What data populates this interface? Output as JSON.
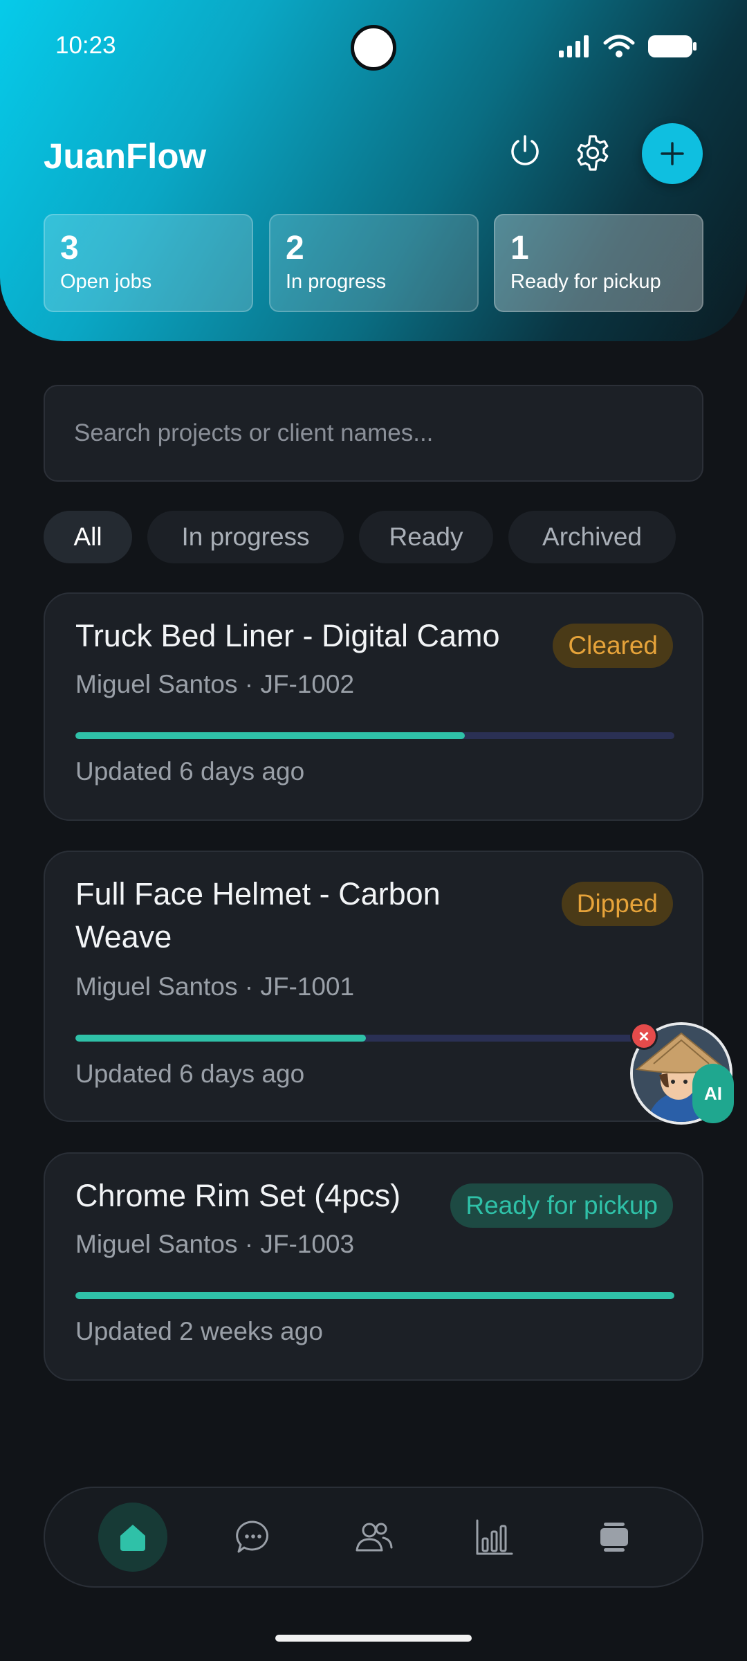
{
  "status_bar": {
    "time": "10:23"
  },
  "header": {
    "app_title": "JuanFlow",
    "power_icon": "power-icon",
    "settings_icon": "gear-icon",
    "add_icon": "plus-icon",
    "stats": [
      {
        "value": "3",
        "label": "Open jobs"
      },
      {
        "value": "2",
        "label": "In progress"
      },
      {
        "value": "1",
        "label": "Ready for pickup"
      }
    ]
  },
  "search": {
    "placeholder": "Search projects or client names...",
    "value": ""
  },
  "filters": [
    {
      "label": "All",
      "active": true
    },
    {
      "label": "In progress",
      "active": false
    },
    {
      "label": "Ready",
      "active": false
    },
    {
      "label": "Archived",
      "active": false
    }
  ],
  "projects": [
    {
      "title": "Truck Bed Liner - Digital Camo",
      "client": "Miguel Santos · JF-1002",
      "status": "Cleared",
      "status_color": "#e6a33a",
      "progress": 0.65,
      "updated": "Updated 6 days ago"
    },
    {
      "title": "Full Face Helmet - Carbon Weave",
      "client": "Miguel Santos · JF-1001",
      "status": "Dipped",
      "status_color": "#e6a33a",
      "progress": 0.485,
      "updated": "Updated 6 days ago"
    },
    {
      "title": "Chrome Rim Set (4pcs)",
      "client": "Miguel Santos · JF-1003",
      "status": "Ready for pickup",
      "status_color": "#2fc1a8",
      "progress": 1.0,
      "updated": "Updated 2 weeks ago"
    }
  ],
  "assistant": {
    "tag": "AI",
    "close_icon": "close-icon"
  },
  "bottom_nav": [
    {
      "icon": "home-icon",
      "active": true
    },
    {
      "icon": "chat-icon",
      "active": false
    },
    {
      "icon": "users-icon",
      "active": false
    },
    {
      "icon": "bar-chart-icon",
      "active": false
    },
    {
      "icon": "layers-icon",
      "active": false
    }
  ],
  "colors": {
    "accent": "#0fbfe0",
    "progress_fill": "#2fc1a8",
    "progress_track": "#2a3054",
    "background": "#111418"
  }
}
